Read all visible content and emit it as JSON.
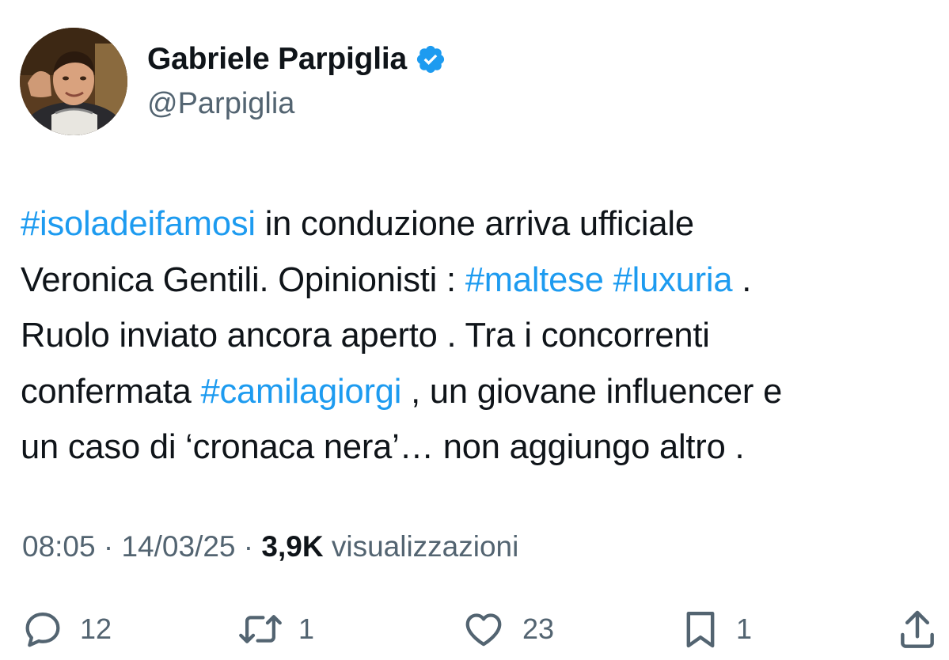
{
  "author": {
    "display_name": "Gabriele Parpiglia",
    "handle": "@Parpiglia",
    "verified": true,
    "verified_color": "#1d9bf0"
  },
  "tweet": {
    "lines": [
      [
        {
          "t": "#isoladeifamosi",
          "tag": true
        },
        {
          "t": " in conduzione arriva ufficiale",
          "tag": false
        }
      ],
      [
        {
          "t": "Veronica Gentili. Opinionisti : ",
          "tag": false
        },
        {
          "t": "#maltese",
          "tag": true
        },
        {
          "t": " ",
          "tag": false
        },
        {
          "t": "#luxuria",
          "tag": true
        },
        {
          "t": " .",
          "tag": false
        }
      ],
      [
        {
          "t": "Ruolo inviato ancora aperto . Tra i concorrenti",
          "tag": false
        }
      ],
      [
        {
          "t": "confermata ",
          "tag": false
        },
        {
          "t": "#camilagiorgi",
          "tag": true
        },
        {
          "t": " , un giovane influencer e",
          "tag": false
        }
      ],
      [
        {
          "t": "un caso di ‘cronaca nera’… non aggiungo altro .",
          "tag": false
        }
      ]
    ],
    "hashtag_color": "#1d9bf0"
  },
  "meta": {
    "time": "08:05",
    "separator": " · ",
    "date": "14/03/25",
    "views_count": "3,9K",
    "views_label": " visualizzazioni"
  },
  "actions": {
    "replies": "12",
    "reposts": "1",
    "likes": "23",
    "bookmarks": "1",
    "reply_icon": "speech-bubble",
    "repost_icon": "repeat-arrows",
    "like_icon": "heart",
    "bookmark_icon": "bookmark",
    "share_icon": "upload-arrow"
  }
}
